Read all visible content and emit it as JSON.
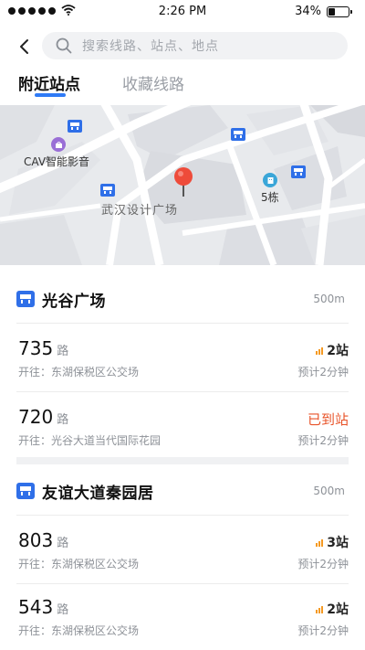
{
  "status_bar": {
    "time": "2:26 PM",
    "battery": "34%",
    "battery_level": 0.34
  },
  "search": {
    "placeholder": "搜索线路、站点、地点"
  },
  "tabs": [
    {
      "label": "附近站点",
      "active": true
    },
    {
      "label": "收藏线路",
      "active": false
    }
  ],
  "map": {
    "labels": {
      "cav": "CAV智能影音",
      "wuhan": "武汉设计广场",
      "building5": "5栋"
    }
  },
  "stations": [
    {
      "name": "光谷广场",
      "distance": "500m",
      "routes": [
        {
          "number": "735",
          "lu": "路",
          "dest": "开往：东湖保税区公交场",
          "status": "2站",
          "eta": "预计2分钟",
          "arrived": false
        },
        {
          "number": "720",
          "lu": "路",
          "dest": "开往：光谷大道当代国际花园",
          "status": "已到站",
          "eta": "预计2分钟",
          "arrived": true
        }
      ]
    },
    {
      "name": "友谊大道秦园居",
      "distance": "500m",
      "routes": [
        {
          "number": "803",
          "lu": "路",
          "dest": "开往：东湖保税区公交场",
          "status": "3站",
          "eta": "预计2分钟",
          "arrived": false
        },
        {
          "number": "543",
          "lu": "路",
          "dest": "开往：东湖保税区公交场",
          "status": "2站",
          "eta": "预计2分钟",
          "arrived": false
        }
      ]
    }
  ],
  "colors": {
    "accent": "#2f7bf6",
    "arrived": "#e8542a",
    "signal": "#f59a23",
    "station_icon": "#2f6fe8"
  }
}
